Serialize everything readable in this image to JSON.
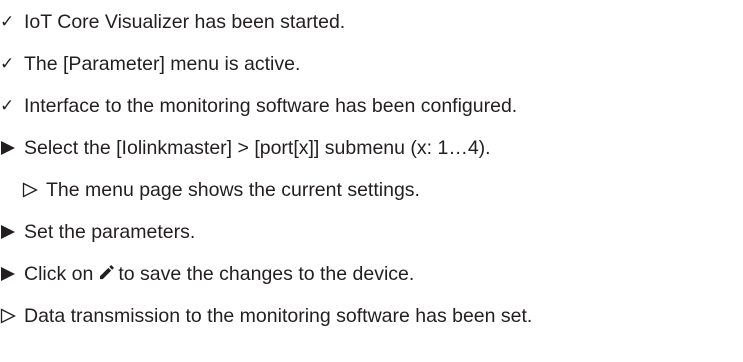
{
  "colors": {
    "text": "#231f20",
    "marker": "#231f20"
  },
  "steps": [
    {
      "kind": "precondition",
      "icon": "checkmark-icon",
      "text": "IoT Core Visualizer has been started."
    },
    {
      "kind": "precondition",
      "icon": "checkmark-icon",
      "text": "The [Parameter] menu is active."
    },
    {
      "kind": "precondition",
      "icon": "checkmark-icon",
      "text": "Interface to the monitoring software has been configured."
    },
    {
      "kind": "action",
      "icon": "filled-triangle-icon",
      "text": "Select the [Iolinkmaster] > [port[x]] submenu (x: 1…4)."
    },
    {
      "kind": "intermediate-result",
      "icon": "outline-triangle-icon",
      "text": "The menu page shows the current settings."
    },
    {
      "kind": "action",
      "icon": "filled-triangle-icon",
      "text": "Set the parameters."
    },
    {
      "kind": "action",
      "icon": "filled-triangle-icon",
      "text_before": "Click on",
      "inline_icon": "pencil-icon",
      "text_after": "to save the changes to the device."
    },
    {
      "kind": "result",
      "icon": "outline-triangle-icon",
      "text": "Data transmission to the monitoring software has been set."
    }
  ]
}
